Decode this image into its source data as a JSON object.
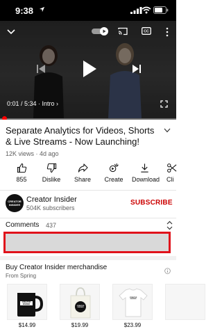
{
  "status_bar": {
    "time": "9:38"
  },
  "player": {
    "timecode": "0:01 / 5:34 · Intro ›"
  },
  "video": {
    "title": "Separate Analytics for Videos, Shorts & Live Streams - Now Launching!",
    "meta": "12K views · 4d ago"
  },
  "actions": [
    {
      "label": "855",
      "icon": "thumbs-up-icon"
    },
    {
      "label": "Dislike",
      "icon": "thumbs-down-icon"
    },
    {
      "label": "Share",
      "icon": "share-icon"
    },
    {
      "label": "Create",
      "icon": "create-icon"
    },
    {
      "label": "Download",
      "icon": "download-icon"
    },
    {
      "label": "Cli",
      "icon": "clip-icon"
    }
  ],
  "channel": {
    "name": "Creator Insider",
    "subscribers": "504K subscribers",
    "avatar_text": "CREATOR INSIDER",
    "subscribe_label": "SUBSCRIBE"
  },
  "comments": {
    "label": "Comments",
    "count": "437"
  },
  "merch": {
    "title": "Buy Creator Insider merchandise",
    "subtitle": "From Spring",
    "products": [
      {
        "price": "$14.99",
        "item": "mug",
        "print": "CREATOR INSIDER"
      },
      {
        "price": "$19.99",
        "item": "tote",
        "print": "CREATOR INSIDER"
      },
      {
        "price": "$23.99",
        "item": "tshirt",
        "print": "CREATOR INSIDER"
      },
      {
        "price": "",
        "item": "partial"
      }
    ]
  },
  "colors": {
    "accent": "#cc0000",
    "highlight_border": "#e0121b",
    "progress": "#ff0000"
  }
}
